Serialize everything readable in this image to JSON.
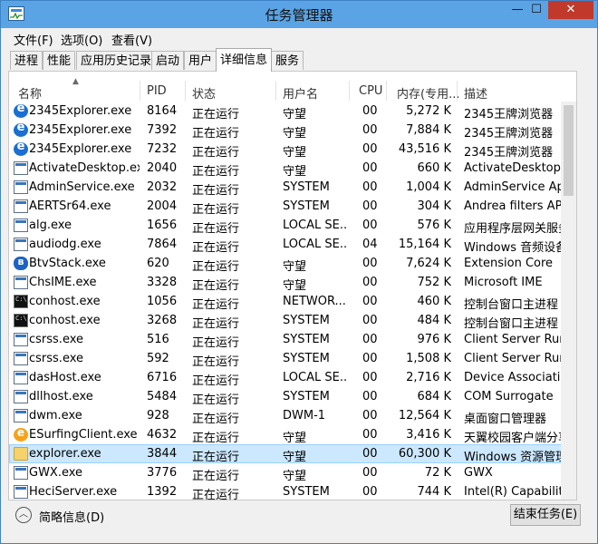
{
  "window": {
    "title": "任务管理器",
    "min_glyph": "—",
    "max_glyph": "☐",
    "close_glyph": "✕"
  },
  "menu": [
    "文件(F)",
    "选项(O)",
    "查看(V)"
  ],
  "tabs": [
    "进程",
    "性能",
    "应用历史记录",
    "启动",
    "用户",
    "详细信息",
    "服务"
  ],
  "active_tab": "详细信息",
  "columns": {
    "name": "名称",
    "pid": "PID",
    "status": "状态",
    "user": "用户名",
    "cpu": "CPU",
    "mem": "内存(专用...",
    "desc": "描述"
  },
  "rows": [
    {
      "icon": "ie-icon",
      "name": "2345Explorer.exe",
      "pid": "8164",
      "status": "正在运行",
      "user": "守望",
      "cpu": "00",
      "mem": "5,272 K",
      "desc": "2345王牌浏览器"
    },
    {
      "icon": "ie-icon",
      "name": "2345Explorer.exe",
      "pid": "7392",
      "status": "正在运行",
      "user": "守望",
      "cpu": "00",
      "mem": "7,884 K",
      "desc": "2345王牌浏览器"
    },
    {
      "icon": "ie-icon",
      "name": "2345Explorer.exe",
      "pid": "7232",
      "status": "正在运行",
      "user": "守望",
      "cpu": "00",
      "mem": "43,516 K",
      "desc": "2345王牌浏览器"
    },
    {
      "icon": "app-window-icon",
      "name": "ActivateDesktop.exe",
      "pid": "2040",
      "status": "正在运行",
      "user": "守望",
      "cpu": "00",
      "mem": "660 K",
      "desc": "ActivateDesktop"
    },
    {
      "icon": "app-window-icon",
      "name": "AdminService.exe",
      "pid": "2032",
      "status": "正在运行",
      "user": "SYSTEM",
      "cpu": "00",
      "mem": "1,004 K",
      "desc": "AdminService App..."
    },
    {
      "icon": "app-window-icon",
      "name": "AERTSr64.exe",
      "pid": "2004",
      "status": "正在运行",
      "user": "SYSTEM",
      "cpu": "00",
      "mem": "304 K",
      "desc": "Andrea filters APO..."
    },
    {
      "icon": "app-window-icon",
      "name": "alg.exe",
      "pid": "1656",
      "status": "正在运行",
      "user": "LOCAL SE...",
      "cpu": "00",
      "mem": "576 K",
      "desc": "应用程序层网关服务"
    },
    {
      "icon": "app-window-icon",
      "name": "audiodg.exe",
      "pid": "7864",
      "status": "正在运行",
      "user": "LOCAL SE...",
      "cpu": "04",
      "mem": "15,164 K",
      "desc": "Windows 音频设备..."
    },
    {
      "icon": "bluetooth-icon",
      "name": "BtvStack.exe",
      "pid": "620",
      "status": "正在运行",
      "user": "守望",
      "cpu": "00",
      "mem": "7,624 K",
      "desc": "Extension Core"
    },
    {
      "icon": "app-window-icon",
      "name": "ChsIME.exe",
      "pid": "3328",
      "status": "正在运行",
      "user": "守望",
      "cpu": "00",
      "mem": "752 K",
      "desc": "Microsoft IME"
    },
    {
      "icon": "console-icon",
      "name": "conhost.exe",
      "pid": "1056",
      "status": "正在运行",
      "user": "NETWOR...",
      "cpu": "00",
      "mem": "460 K",
      "desc": "控制台窗口主进程"
    },
    {
      "icon": "console-icon",
      "name": "conhost.exe",
      "pid": "3268",
      "status": "正在运行",
      "user": "SYSTEM",
      "cpu": "00",
      "mem": "484 K",
      "desc": "控制台窗口主进程"
    },
    {
      "icon": "app-window-icon",
      "name": "csrss.exe",
      "pid": "516",
      "status": "正在运行",
      "user": "SYSTEM",
      "cpu": "00",
      "mem": "976 K",
      "desc": "Client Server Runti..."
    },
    {
      "icon": "app-window-icon",
      "name": "csrss.exe",
      "pid": "592",
      "status": "正在运行",
      "user": "SYSTEM",
      "cpu": "00",
      "mem": "1,508 K",
      "desc": "Client Server Runti..."
    },
    {
      "icon": "app-window-icon",
      "name": "dasHost.exe",
      "pid": "6716",
      "status": "正在运行",
      "user": "LOCAL SE...",
      "cpu": "00",
      "mem": "2,716 K",
      "desc": "Device Association..."
    },
    {
      "icon": "app-window-icon",
      "name": "dllhost.exe",
      "pid": "5484",
      "status": "正在运行",
      "user": "SYSTEM",
      "cpu": "00",
      "mem": "684 K",
      "desc": "COM Surrogate"
    },
    {
      "icon": "app-window-icon",
      "name": "dwm.exe",
      "pid": "928",
      "status": "正在运行",
      "user": "DWM-1",
      "cpu": "00",
      "mem": "12,564 K",
      "desc": "桌面窗口管理器"
    },
    {
      "icon": "esurfing-icon",
      "name": "ESurfingClient.exe",
      "pid": "4632",
      "status": "正在运行",
      "user": "守望",
      "cpu": "00",
      "mem": "3,416 K",
      "desc": "天翼校园客户端分享..."
    },
    {
      "icon": "folder-icon",
      "name": "explorer.exe",
      "pid": "3844",
      "status": "正在运行",
      "user": "守望",
      "cpu": "00",
      "mem": "60,300 K",
      "desc": "Windows 资源管理器",
      "selected": true
    },
    {
      "icon": "app-window-icon",
      "name": "GWX.exe",
      "pid": "3776",
      "status": "正在运行",
      "user": "守望",
      "cpu": "00",
      "mem": "72 K",
      "desc": "GWX"
    },
    {
      "icon": "app-window-icon",
      "name": "HeciServer.exe",
      "pid": "1392",
      "status": "正在运行",
      "user": "SYSTEM",
      "cpu": "00",
      "mem": "744 K",
      "desc": "Intel(R) Capability..."
    }
  ],
  "footer": {
    "less_info": "简略信息(D)",
    "end_task": "结束任务(E)"
  }
}
